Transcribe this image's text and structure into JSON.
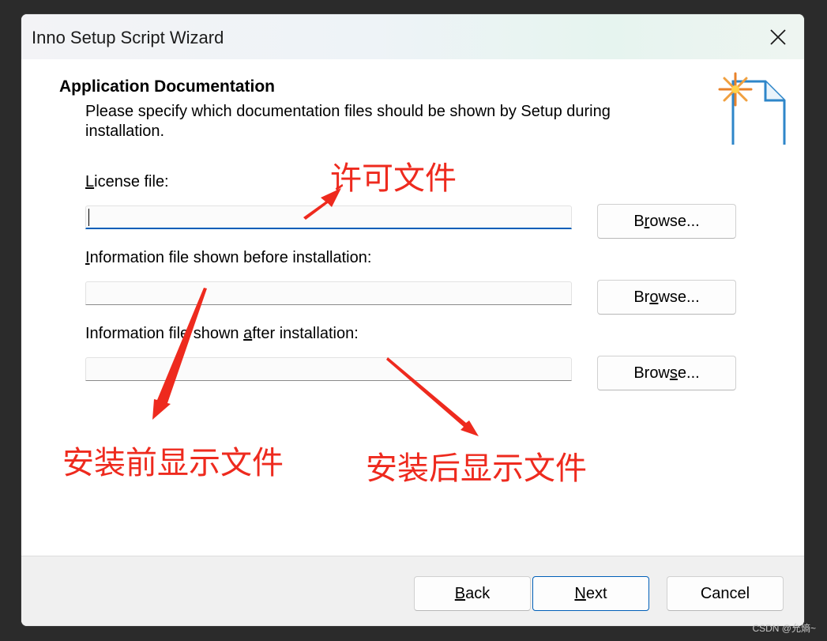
{
  "window": {
    "title": "Inno Setup Script Wizard"
  },
  "page": {
    "heading": "Application Documentation",
    "description": "Please specify which documentation files should be shown by Setup during installation."
  },
  "fields": [
    {
      "label_pre": "",
      "label_accel": "L",
      "label_post": "icense file:",
      "value": "",
      "browse": {
        "pre": "B",
        "accel": "r",
        "post": "owse..."
      }
    },
    {
      "label_pre": "",
      "label_accel": "I",
      "label_post": "nformation file shown before installation:",
      "value": "",
      "browse": {
        "pre": "Br",
        "accel": "o",
        "post": "wse..."
      }
    },
    {
      "label_pre": "Information file shown ",
      "label_accel": "a",
      "label_post": "fter installation:",
      "value": "",
      "browse": {
        "pre": "Brow",
        "accel": "s",
        "post": "e..."
      }
    }
  ],
  "annotations": {
    "license": "许可文件",
    "before": "安装前显示文件",
    "after": "安装后显示文件",
    "color": "#ee2a1e"
  },
  "footer": {
    "back": {
      "accel": "B",
      "post": "ack"
    },
    "next": {
      "accel": "N",
      "post": "ext"
    },
    "cancel": "Cancel"
  },
  "watermark": "CSDN @允熵~",
  "icons": {
    "close": "close-icon",
    "document": "new-document-icon"
  },
  "colors": {
    "accent": "#005fb8",
    "annotation": "#ee2a1e"
  }
}
